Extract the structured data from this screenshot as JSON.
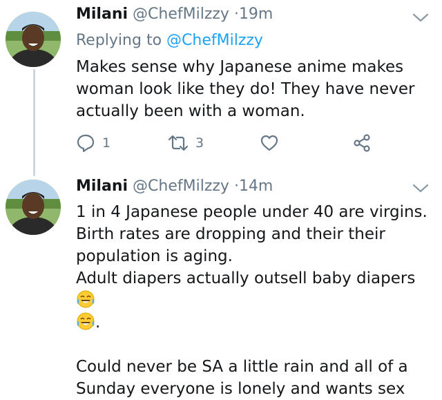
{
  "tweets": [
    {
      "name": "Milani",
      "handle": "@ChefMilzzy",
      "dot": "·",
      "time": "19m",
      "replying_prefix": "Replying to ",
      "replying_to": "@ChefMilzzy",
      "text": "Makes sense why Japanese anime makes\nwoman look like they do! They have never\nactually been with a woman.",
      "reply_count": "1",
      "retweet_count": "3"
    },
    {
      "name": "Milani",
      "handle": "@ChefMilzzy",
      "dot": "·",
      "time": "14m",
      "text_lines": [
        "1 in 4 Japanese people under 40 are virgins.",
        "Birth rates are dropping and their their",
        "population is aging.",
        "Adult diapers actually outsell baby diapers"
      ],
      "text_after_emoji": ".",
      "text_paragraph2": "Could never be SA a little rain and all of a\nSunday everyone is lonely and wants sex"
    }
  ],
  "colors": {
    "text": "#14171a",
    "secondary": "#657786",
    "link": "#1da1f2",
    "thread_line": "#ccd6dd"
  },
  "icons": [
    "reply-icon",
    "retweet-icon",
    "like-icon",
    "share-icon",
    "chevron-down-icon",
    "tears-of-joy-emoji"
  ]
}
